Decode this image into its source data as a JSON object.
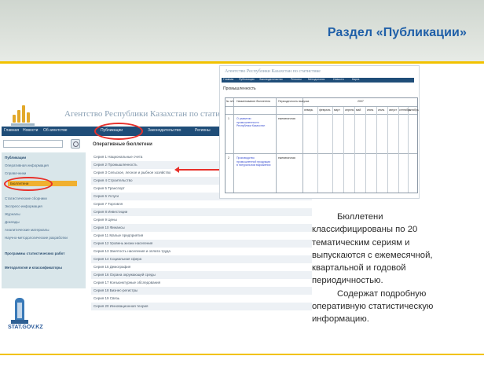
{
  "slide": {
    "title": "Раздел «Публикации»",
    "description_lines": [
      "Бюллетени",
      "классифицированы по 20",
      "тематическим сериям и",
      "выпускаются с ежемесячной,",
      "квартальной и годовой",
      "периодичностью.",
      "Содержат подробную",
      "оперативную статистическую",
      "информацию."
    ]
  },
  "site": {
    "name": "Агентство Республики Казахстан по статистике",
    "nav": [
      "Главная",
      "Новости",
      "Об агентстве",
      "Публикации",
      "Законодательство",
      "Регионы"
    ],
    "content_title": "Оперативные бюллетени",
    "sidebar": {
      "header1": "Публикации",
      "items": [
        "Оперативная информация",
        "Справочники",
        "Бюллетени",
        "Статистические сборники",
        "Экспресс-информация",
        "Журналы",
        "Доклады",
        "Аналитические материалы",
        "Научно-методологические разработки"
      ],
      "header2": "Программы статистических работ",
      "header3": "Методология и классификаторы"
    },
    "logo_text": "STAT.GOV.KZ",
    "series": [
      "Серия 1 Национальные счета",
      "Серия 2 Промышленность",
      "Серия 3 Сельское, лесное и рыбное хозяйство",
      "Серия 4 Строительство",
      "Серия 5 Транспорт",
      "Серия 6 Услуги",
      "Серия 7 Торговля",
      "Серия 8 Инвестиции",
      "Серия 9 Цены",
      "Серия 10 Финансы",
      "Серия 11 Малые предприятия",
      "Серия 12 Уровень жизни населения",
      "Серия 13 Занятость населения и оплата труда",
      "Серия 14 Социальная сфера",
      "Серия 15 Демография",
      "Серия 16 Охрана окружающей среды",
      "Серия 17 Конъюнктурные обследования",
      "Серия 18 Бизнес-регистры",
      "Серия 19 Связь",
      "Серия 20 Инновационная теория"
    ]
  },
  "inset": {
    "name": "Агентство Республики Казахстан по статистике",
    "nav": [
      "Главная",
      "Публикации",
      "Законодательство",
      "Регионы",
      "Методология",
      "Новости",
      "Карта"
    ],
    "category": "Промышленность",
    "headers": {
      "num": "№ п/п",
      "name": "Наименование бюллетеня",
      "period": "Периодичность выпуска",
      "year": "2007"
    },
    "months": [
      "январь",
      "февраль",
      "март",
      "апрель",
      "май",
      "июнь",
      "июль",
      "август",
      "сентябрь",
      "октябрь"
    ],
    "rows": [
      {
        "num": "1",
        "name": "О развитии промышленности Республики Казахстан",
        "period": "ежемесячная"
      },
      {
        "num": "2",
        "name": "Производство промышленной продукции в натуральном выражении",
        "period": "ежемесячная"
      }
    ]
  }
}
